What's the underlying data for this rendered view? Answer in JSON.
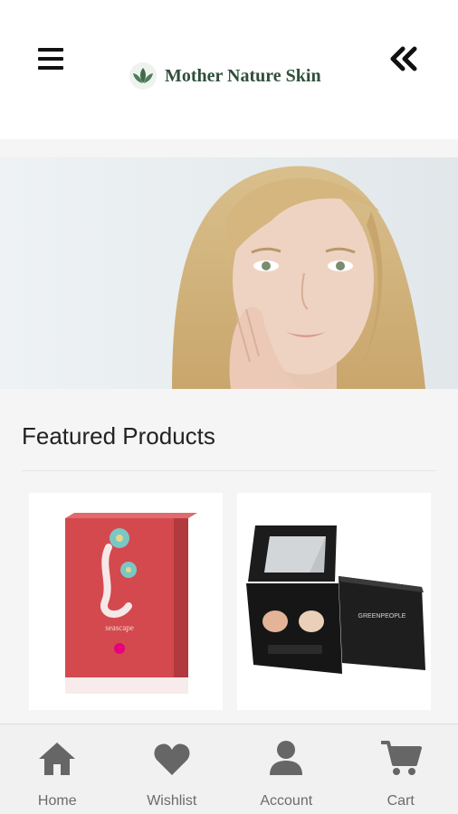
{
  "header": {
    "brand_name": "Mother Nature Skin",
    "icons": {
      "menu": "hamburger-menu-icon",
      "back": "double-chevron-left-icon",
      "logo": "leaf-logo-icon"
    }
  },
  "hero": {
    "image": "woman-portrait-banner"
  },
  "featured": {
    "title": "Featured Products",
    "products": [
      {
        "image": "seascape-perfume-box",
        "box_text": "seascape"
      },
      {
        "image": "greenpeople-eyeshadow-duo",
        "box_text": "GREENPEOPLE"
      }
    ]
  },
  "tabs": [
    {
      "label": "Home",
      "icon": "home-icon"
    },
    {
      "label": "Wishlist",
      "icon": "heart-icon"
    },
    {
      "label": "Account",
      "icon": "user-icon"
    },
    {
      "label": "Cart",
      "icon": "cart-icon"
    }
  ],
  "colors": {
    "brand_green": "#2f4f3a",
    "tab_icon": "#666666",
    "background": "#f5f5f5"
  }
}
